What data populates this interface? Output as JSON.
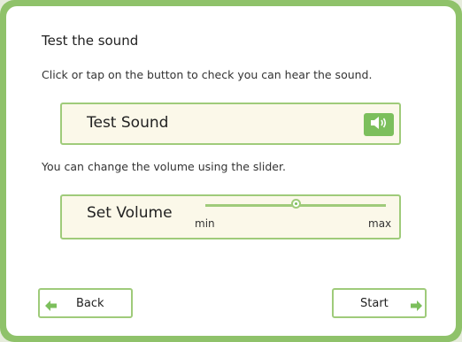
{
  "test_sound": {
    "title": "Test the sound",
    "instruction": "Click or tap on the button to check you can hear the sound.",
    "button_label": "Test Sound"
  },
  "volume": {
    "instruction": "You can change the volume using the slider.",
    "label": "Set Volume",
    "min_label": "min",
    "max_label": "max",
    "level": 0.5
  },
  "nav": {
    "back_label": "Back",
    "start_label": "Start"
  },
  "icons": {
    "sound": "speaker-icon",
    "back": "arrow-left-icon",
    "start": "arrow-right-icon"
  },
  "colors": {
    "accent": "#7cbf5c",
    "border": "#9fcb7a",
    "panel_bg": "#fbf8e9"
  }
}
